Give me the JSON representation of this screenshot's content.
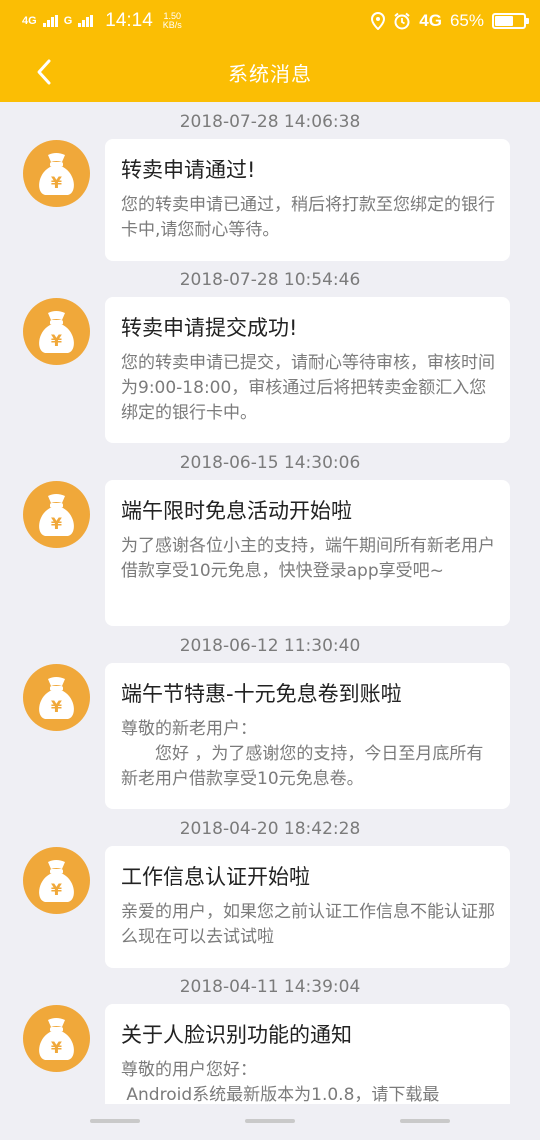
{
  "status_bar": {
    "network_left": "4G",
    "network_left2": "G",
    "time": "14:14",
    "speed_value": "1.50",
    "speed_unit": "KB/s",
    "network_right": "4G",
    "battery_percent": "65%",
    "battery_level": 0.65
  },
  "header": {
    "title": "系统消息",
    "color": "#fbbe04"
  },
  "messages": [
    {
      "date": "2018-07-28 14:06:38",
      "title": "转卖申请通过!",
      "body": "您的转卖申请已通过，稍后将打款至您绑定的银行卡中,请您耐心等待。"
    },
    {
      "date": "2018-07-28 10:54:46",
      "title": "转卖申请提交成功!",
      "body": "您的转卖申请已提交，请耐心等待审核，审核时间为9:00-18:00，审核通过后将把转卖金额汇入您绑定的银行卡中。"
    },
    {
      "date": "2018-06-15 14:30:06",
      "title": "端午限时免息活动开始啦",
      "body": "为了感谢各位小主的支持，端午期间所有新老用户借款享受10元免息，快快登录app享受吧~"
    },
    {
      "date": "2018-06-12 11:30:40",
      "title": "端午节特惠-十元免息卷到账啦",
      "body": "尊敬的新老用户：\n　　您好 ，为了感谢您的支持，今日至月底所有新老用户借款享受10元免息卷。"
    },
    {
      "date": "2018-04-20 18:42:28",
      "title": "工作信息认证开始啦",
      "body": "亲爱的用户，如果您之前认证工作信息不能认证那么现在可以去试试啦"
    },
    {
      "date": "2018-04-11 14:39:04",
      "title": "关于人脸识别功能的通知",
      "body": "尊敬的用户您好：\n Android系统最新版本为1.0.8，请下载最"
    }
  ],
  "avatar_icon": "money-bag-yen-icon",
  "avatar_symbol": "¥",
  "accent": "#f0a83a"
}
